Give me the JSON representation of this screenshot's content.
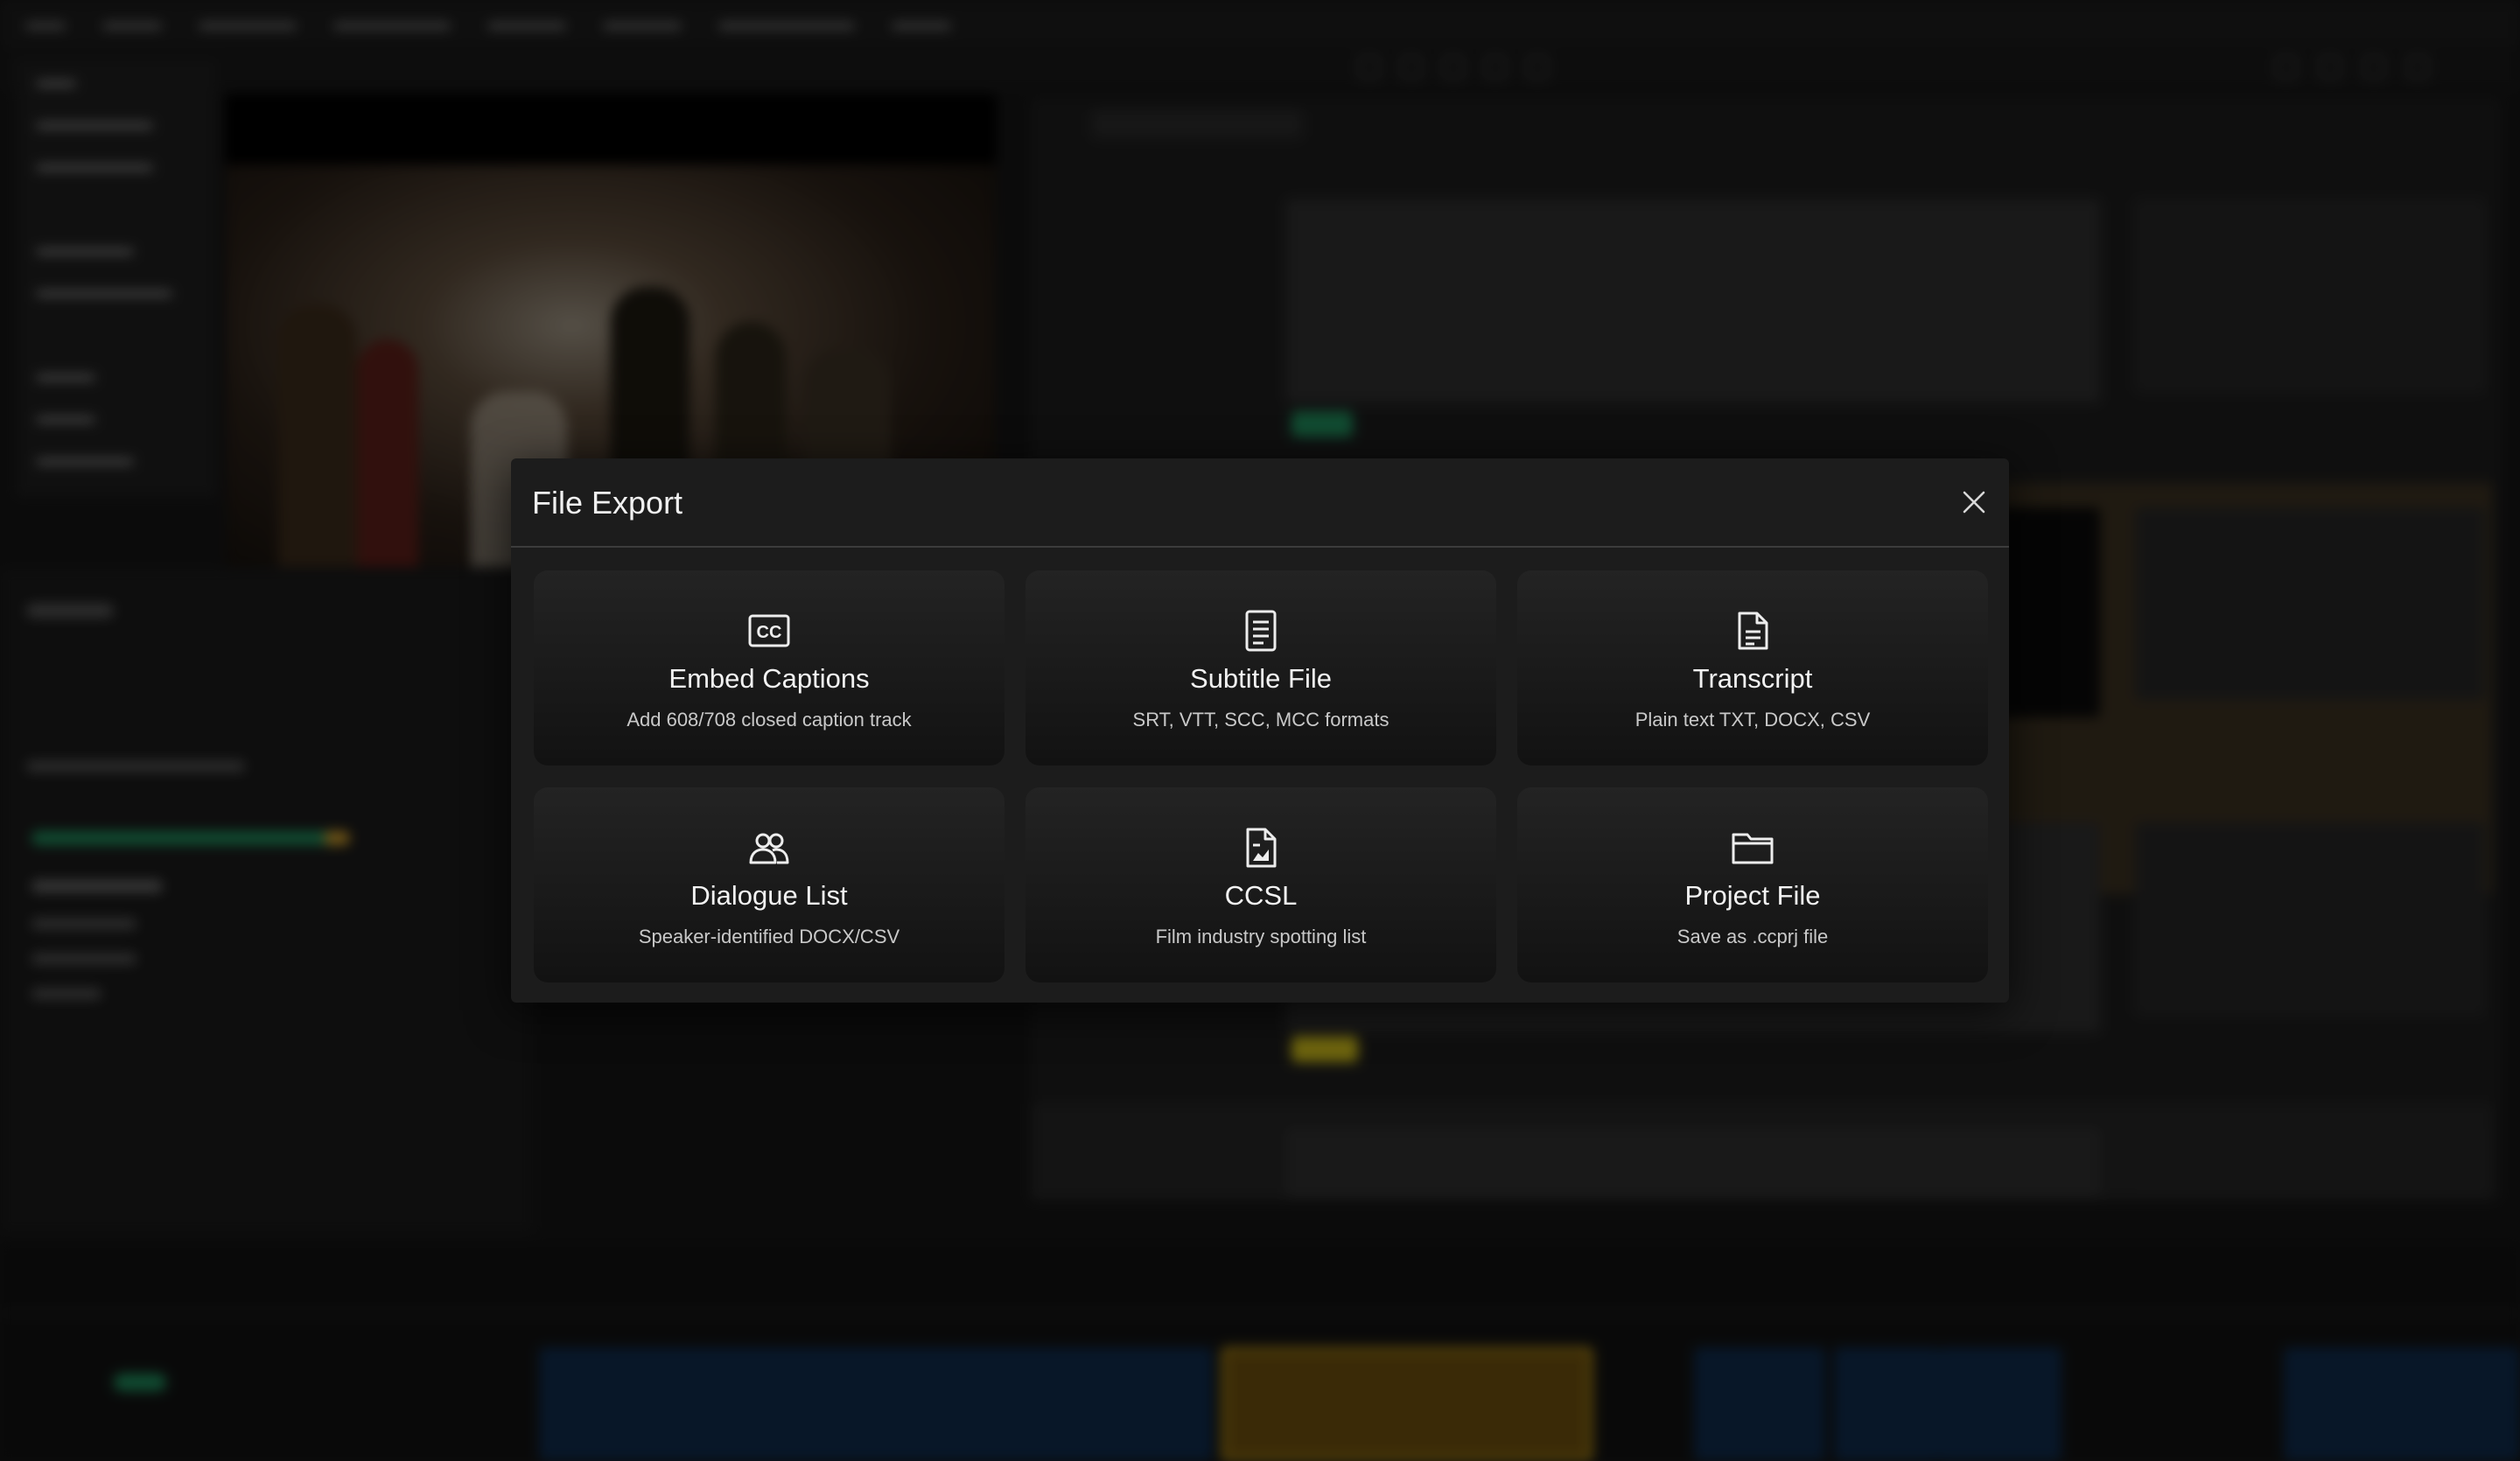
{
  "dialog": {
    "title": "File Export",
    "close_label": "×"
  },
  "options": [
    {
      "title": "Embed Captions",
      "description": "Add 608/708 closed caption track",
      "icon": "closed-caption-icon"
    },
    {
      "title": "Subtitle File",
      "description": "SRT, VTT, SCC, MCC formats",
      "icon": "document-lines-icon"
    },
    {
      "title": "Transcript",
      "description": "Plain text TXT, DOCX, CSV",
      "icon": "transcript-file-icon"
    },
    {
      "title": "Dialogue List",
      "description": "Speaker-identified DOCX/CSV",
      "icon": "people-icon"
    },
    {
      "title": "CCSL",
      "description": "Film industry spotting list",
      "icon": "spotting-file-icon"
    },
    {
      "title": "Project File",
      "description": "Save as .ccprj file",
      "icon": "folder-icon"
    }
  ],
  "colors": {
    "card_top": "#232323",
    "card_bottom": "#121212",
    "dialog_bg": "#1c1c1c",
    "clip_blue": "#0f2a4a",
    "clip_gold": "#6b4e0e"
  }
}
